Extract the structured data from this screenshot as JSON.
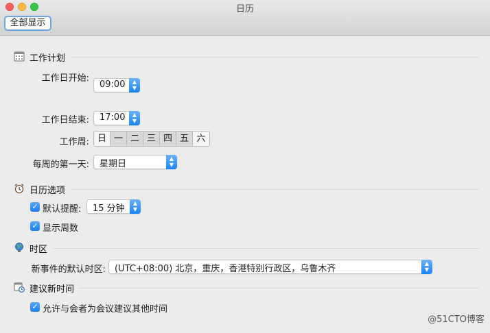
{
  "window": {
    "title": "日历"
  },
  "toolbar": {
    "show_all_label": "全部显示"
  },
  "work_schedule": {
    "title": "工作计划",
    "day_start_label": "工作日开始:",
    "day_start_value": "09:00",
    "day_end_label": "工作日结束:",
    "day_end_value": "17:00",
    "work_week_label": "工作周:",
    "days": [
      {
        "label": "日",
        "selected": false
      },
      {
        "label": "一",
        "selected": true
      },
      {
        "label": "二",
        "selected": true
      },
      {
        "label": "三",
        "selected": true
      },
      {
        "label": "四",
        "selected": true
      },
      {
        "label": "五",
        "selected": true
      },
      {
        "label": "六",
        "selected": false
      }
    ],
    "first_day_label": "每周的第一天:",
    "first_day_value": "星期日"
  },
  "calendar_options": {
    "title": "日历选项",
    "reminder_label": "默认提醒:",
    "reminder_checked": true,
    "reminder_value": "15 分钟",
    "week_numbers_label": "显示周数",
    "week_numbers_checked": true
  },
  "time_zone": {
    "title": "时区",
    "default_tz_label": "新事件的默认时区:",
    "default_tz_value": "(UTC+08:00) 北京，重庆，香港特别行政区，乌鲁木齐"
  },
  "propose_new_time": {
    "title": "建议新时间",
    "allow_label": "允许与会者为会议建议其他时间",
    "allow_checked": true
  },
  "watermark": "@51CTO博客",
  "colors": {
    "accent": "#1a82fb",
    "focus_ring": "#6aa3e8"
  }
}
